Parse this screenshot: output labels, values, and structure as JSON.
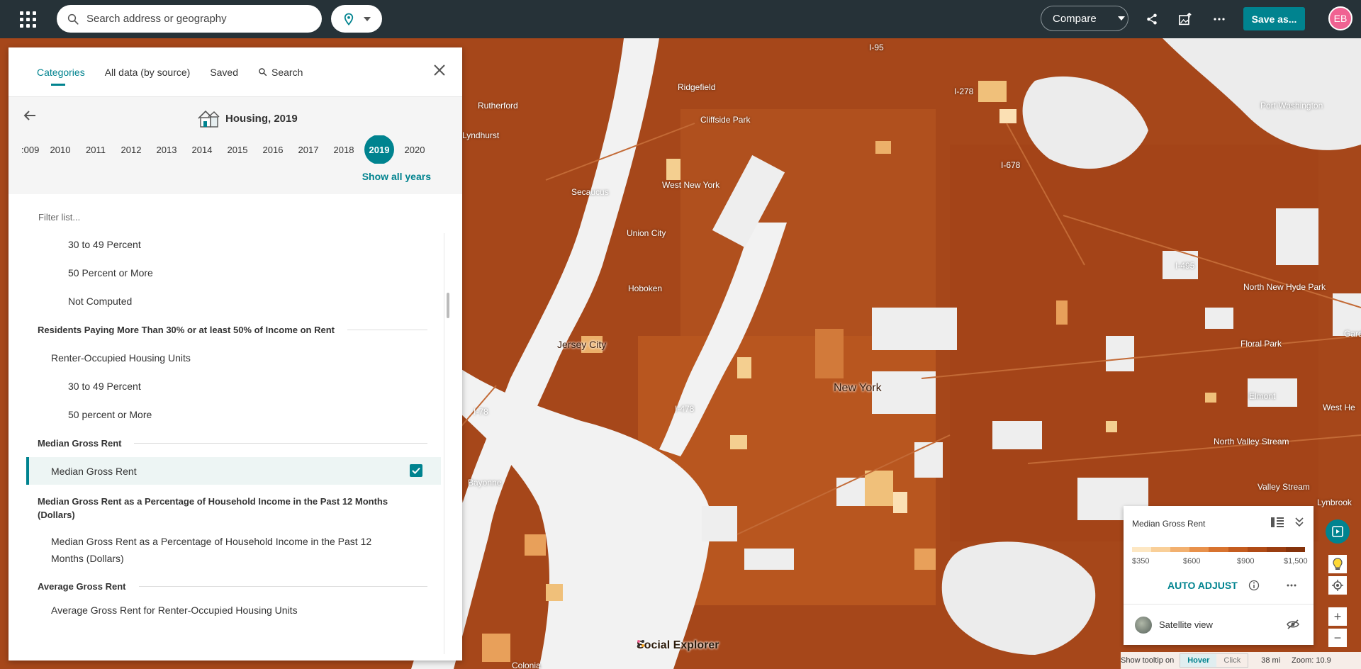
{
  "search": {
    "placeholder": "Search address or geography"
  },
  "toolbar": {
    "compare_label": "Compare",
    "save_label": "Save as...",
    "avatar_initials": "EB"
  },
  "panel": {
    "tabs": [
      "Categories",
      "All data (by source)",
      "Saved",
      "Search"
    ],
    "dataset_title": "Housing, 2019",
    "years": [
      ":009",
      "2010",
      "2011",
      "2012",
      "2013",
      "2014",
      "2015",
      "2016",
      "2017",
      "2018",
      "2019",
      "2020"
    ],
    "selected_year": "2019",
    "show_all_years": "Show all years",
    "filter_placeholder": "Filter list...",
    "list": {
      "item_30_49": "30 to 49 Percent",
      "item_50_more": "50 Percent or More",
      "item_not_computed": "Not Computed",
      "section_residents": "Residents Paying More Than 30% or at least 50% of Income on Rent",
      "item_renter_occupied": "Renter-Occupied Housing Units",
      "item_30_49_b": "30 to 49 Percent",
      "item_50_more_b": "50 percent or More",
      "section_median": "Median Gross Rent",
      "item_median_selected": "Median Gross Rent",
      "section_median_pct_1": "Median Gross Rent as a Percentage of Household Income in the Past 12 Months",
      "section_median_pct_2": "(Dollars)",
      "item_median_pct_1": "Median Gross Rent as a Percentage of Household Income in the Past 12",
      "item_median_pct_2": "Months (Dollars)",
      "section_average": "Average Gross Rent",
      "item_average": "Average Gross Rent for Renter-Occupied Housing Units"
    }
  },
  "legend": {
    "title": "Median Gross Rent",
    "colors": [
      "#fde7c3",
      "#f9cf98",
      "#f2b06f",
      "#e8914b",
      "#d8732f",
      "#c45c1f",
      "#b04b16",
      "#9a3d10",
      "#84320b"
    ],
    "ticks": [
      "$350",
      "$600",
      "$900",
      "$1,500"
    ],
    "auto_adjust": "AUTO ADJUST",
    "satellite_label": "Satellite view"
  },
  "statusbar": {
    "tooltip_label": "Show tooltip on",
    "hover": "Hover",
    "click": "Click",
    "scale": "38 mi",
    "zoom": "Zoom: 10.9"
  },
  "map": {
    "brand": "Social Explorer",
    "labels": {
      "new_york": "New York",
      "jersey_city": "Jersey City",
      "union_city": "Union City",
      "hoboken": "Hoboken",
      "west_new_york": "West New York",
      "secaucus": "Secaucus",
      "bayonne": "Bayonne",
      "rutherford": "Rutherford",
      "lyndhurst": "Lyndhurst",
      "ridgefield": "Ridgefield",
      "cliffside_park": "Cliffside Park",
      "port_washington": "Port Washington",
      "new_hyde_park": "North New Hyde Park",
      "floral_park": "Floral Park",
      "elmont": "Elmont",
      "north_valley_stream": "North Valley Stream",
      "valley_stream": "Valley Stream",
      "lynbrook": "Lynbrook",
      "west_he": "West He",
      "garde": "Garde",
      "colonia": "Colonia",
      "i678": "I-678",
      "i495": "I-495",
      "i278": "I-278",
      "i78": "I-78",
      "i478": "I-478",
      "i95": "I-95"
    }
  }
}
